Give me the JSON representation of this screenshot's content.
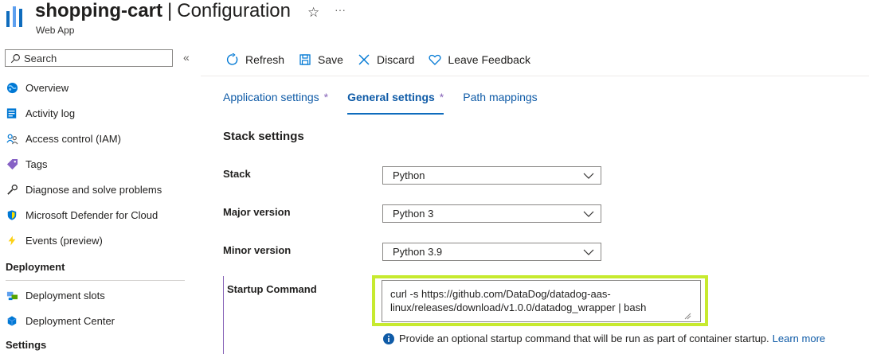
{
  "header": {
    "resource_name": "shopping-cart",
    "separator": "|",
    "page_title": "Configuration",
    "subtitle": "Web App",
    "favorite_icon": "star-outline-icon",
    "more_icon": "ellipsis-icon"
  },
  "sidebar": {
    "search_placeholder": "Search",
    "collapse_icon": "double-chevron-left-icon",
    "items": [
      {
        "label": "Overview",
        "icon": "globe-icon"
      },
      {
        "label": "Activity log",
        "icon": "activity-log-icon"
      },
      {
        "label": "Access control (IAM)",
        "icon": "people-icon"
      },
      {
        "label": "Tags",
        "icon": "tag-icon"
      },
      {
        "label": "Diagnose and solve problems",
        "icon": "wrench-icon"
      },
      {
        "label": "Microsoft Defender for Cloud",
        "icon": "shield-icon"
      },
      {
        "label": "Events (preview)",
        "icon": "lightning-icon"
      }
    ],
    "deployment_section": {
      "title": "Deployment",
      "items": [
        {
          "label": "Deployment slots",
          "icon": "deployment-slots-icon"
        },
        {
          "label": "Deployment Center",
          "icon": "cube-icon"
        }
      ]
    },
    "settings_section": {
      "title": "Settings"
    }
  },
  "toolbar": {
    "refresh": "Refresh",
    "save": "Save",
    "discard": "Discard",
    "feedback": "Leave Feedback"
  },
  "tabs": [
    {
      "label": "Application settings",
      "modified": "*",
      "active": false
    },
    {
      "label": "General settings",
      "modified": "*",
      "active": true
    },
    {
      "label": "Path mappings",
      "modified": "",
      "active": false
    }
  ],
  "stack_settings": {
    "heading": "Stack settings",
    "stack": {
      "label": "Stack",
      "value": "Python"
    },
    "major_version": {
      "label": "Major version",
      "value": "Python 3"
    },
    "minor_version": {
      "label": "Minor version",
      "value": "Python 3.9"
    },
    "startup_command": {
      "label": "Startup Command",
      "value": "curl -s https://github.com/DataDog/datadog-aas-linux/releases/download/v1.0.0/datadog_wrapper | bash",
      "info_text": "Provide an optional startup command that will be run as part of container startup.",
      "learn_more": "Learn more"
    }
  },
  "colors": {
    "accent_blue": "#0f5ba7",
    "modified_marker": "#8764b8",
    "highlight": "#c7ea2f"
  }
}
